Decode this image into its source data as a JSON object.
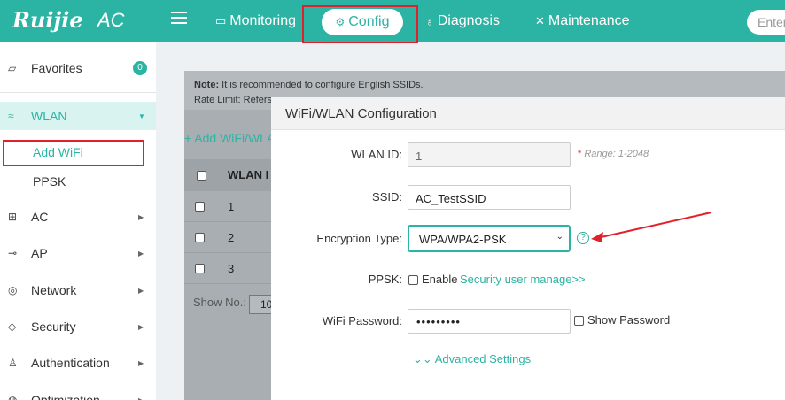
{
  "header": {
    "logo": "Ruijie",
    "product": "AC",
    "nav": [
      {
        "label": "Monitoring",
        "icon": "monitor-icon"
      },
      {
        "label": "Config",
        "icon": "gear-icon"
      },
      {
        "label": "Diagnosis",
        "icon": "stethoscope-icon"
      },
      {
        "label": "Maintenance",
        "icon": "tools-icon"
      }
    ],
    "search_placeholder": "Enter"
  },
  "sidebar": {
    "favorites": {
      "label": "Favorites",
      "count": "0"
    },
    "items": [
      {
        "label": "WLAN",
        "icon": "wifi-icon"
      },
      {
        "label": "AC",
        "icon": "ac-icon"
      },
      {
        "label": "AP",
        "icon": "ap-icon"
      },
      {
        "label": "Network",
        "icon": "globe-icon"
      },
      {
        "label": "Security",
        "icon": "shield-icon"
      },
      {
        "label": "Authentication",
        "icon": "user-icon"
      },
      {
        "label": "Optimization",
        "icon": "optimize-icon"
      }
    ],
    "wlan_sub": [
      "Add WiFi",
      "PPSK"
    ]
  },
  "background": {
    "note_title": "Note:",
    "note_line1": "It is recommended to configure English SSIDs.",
    "note_line2": "Rate Limit: Refers",
    "add_link": "+ Add WiFi/WLA",
    "table_header": "WLAN I",
    "rows": [
      "1",
      "2",
      "3"
    ],
    "show_no_label": "Show No.:",
    "show_no_value": "10"
  },
  "modal": {
    "title": "WiFi/WLAN Configuration",
    "wlan_id_label": "WLAN ID:",
    "wlan_id_value": "1",
    "range_star": "*",
    "range_hint": "Range: 1-2048",
    "ssid_label": "SSID:",
    "ssid_value": "AC_TestSSID",
    "encryption_label": "Encryption Type:",
    "encryption_value": "WPA/WPA2-PSK",
    "ppsk_label": "PPSK:",
    "ppsk_enable": "Enable",
    "ppsk_link": "Security user manage>>",
    "password_label": "WiFi Password:",
    "password_value": "•••••••••",
    "show_password": "Show Password",
    "advanced": "Advanced Settings"
  },
  "colors": {
    "accent": "#2bb3a3",
    "highlight": "#e0202a"
  }
}
